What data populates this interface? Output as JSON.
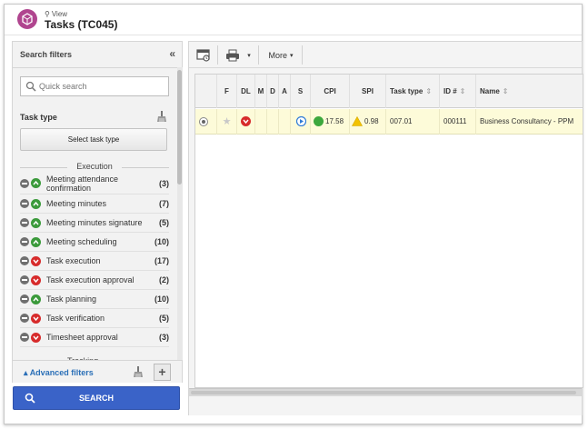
{
  "header": {
    "view_label": "View",
    "title": "Tasks (TC045)",
    "logo_color": "#b0458f"
  },
  "search_filters": {
    "title": "Search filters",
    "collapse_glyph": "«",
    "quick_search_placeholder": "Quick search",
    "task_type_label": "Task type",
    "select_task_type_label": "Select task type",
    "section_execution": "Execution",
    "section_tracking": "Tracking",
    "items": [
      {
        "label": "Meeting attendance confirmation",
        "count": "(3)",
        "status": "up"
      },
      {
        "label": "Meeting minutes",
        "count": "(7)",
        "status": "up"
      },
      {
        "label": "Meeting minutes signature",
        "count": "(5)",
        "status": "up"
      },
      {
        "label": "Meeting scheduling",
        "count": "(10)",
        "status": "up"
      },
      {
        "label": "Task execution",
        "count": "(17)",
        "status": "down"
      },
      {
        "label": "Task execution approval",
        "count": "(2)",
        "status": "down"
      },
      {
        "label": "Task planning",
        "count": "(10)",
        "status": "up"
      },
      {
        "label": "Task verification",
        "count": "(5)",
        "status": "down"
      },
      {
        "label": "Timesheet approval",
        "count": "(3)",
        "status": "down"
      }
    ],
    "advanced_filters_label": "Advanced filters",
    "search_button_label": "SEARCH",
    "accent_color": "#3a63c8"
  },
  "toolbar": {
    "more_label": "More"
  },
  "grid": {
    "columns": [
      "F",
      "DL",
      "M",
      "D",
      "A",
      "S",
      "CPI",
      "SPI",
      "Task type",
      "ID #",
      "Name"
    ],
    "rows": [
      {
        "cpi": "17.58",
        "spi": "0.98",
        "task_type": "007.01",
        "id": "000111",
        "name": "Business Consultancy - PPM"
      }
    ],
    "row_color": "#fdfbd9"
  }
}
